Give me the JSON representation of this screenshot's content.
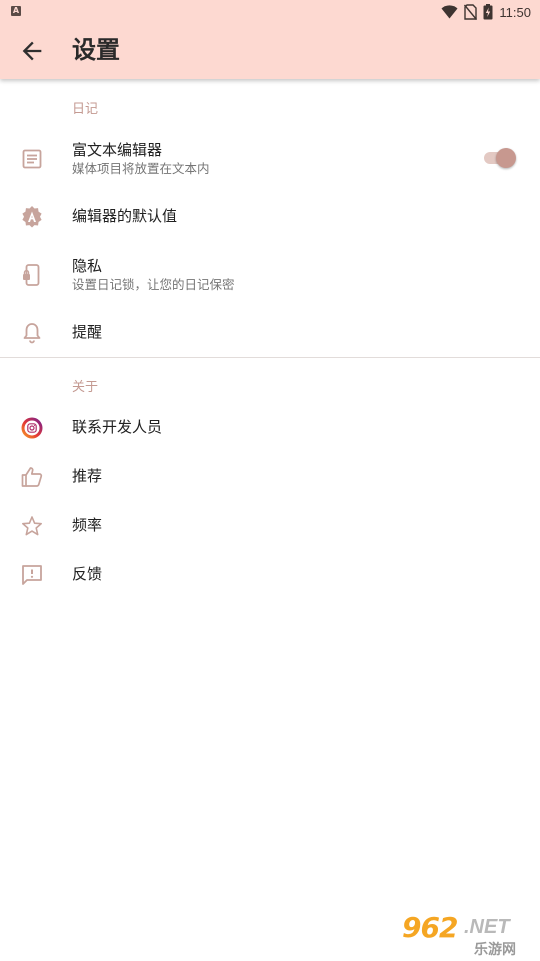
{
  "status_bar": {
    "notification_letter": "A",
    "time": "11:50",
    "icons": [
      "wifi-icon",
      "no-sim-icon",
      "battery-charging-icon"
    ]
  },
  "toolbar": {
    "back_icon": "arrow-back-icon",
    "title": "设置"
  },
  "sections": [
    {
      "header": "日记",
      "items": [
        {
          "title": "富文本编辑器",
          "subtitle": "媒体项目将放置在文本内",
          "icon": "article-icon",
          "toggle": true
        },
        {
          "title": "编辑器的默认值",
          "subtitle": "",
          "icon": "font-settings-icon"
        },
        {
          "title": "隐私",
          "subtitle": "设置日记锁，让您的日记保密",
          "icon": "phone-lock-icon"
        },
        {
          "title": "提醒",
          "subtitle": "",
          "icon": "bell-icon"
        }
      ]
    },
    {
      "header": "关于",
      "items": [
        {
          "title": "联系开发人员",
          "icon": "instagram-icon"
        },
        {
          "title": "推荐",
          "icon": "thumb-up-icon"
        },
        {
          "title": "频率",
          "icon": "star-outline-icon"
        },
        {
          "title": "反馈",
          "icon": "feedback-icon"
        }
      ]
    }
  ],
  "colors": {
    "appbar": "#fdd9d1",
    "accent": "#c7988f",
    "section_header": "#c49a92",
    "icon": "#c7a49c"
  },
  "watermark": {
    "number": "962",
    "suffix": ".NET",
    "text": "乐游网"
  }
}
